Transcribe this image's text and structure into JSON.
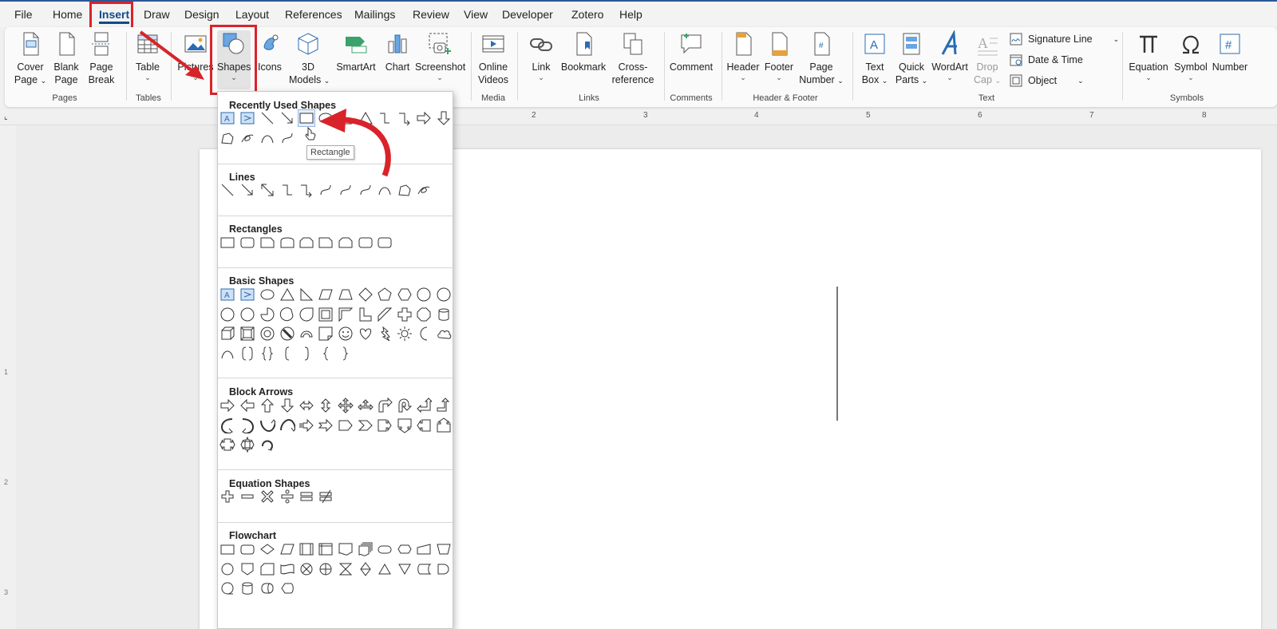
{
  "menu": {
    "tabs": [
      {
        "label": "File"
      },
      {
        "label": "Home"
      },
      {
        "label": "Insert"
      },
      {
        "label": "Draw"
      },
      {
        "label": "Design"
      },
      {
        "label": "Layout"
      },
      {
        "label": "References"
      },
      {
        "label": "Mailings"
      },
      {
        "label": "Review"
      },
      {
        "label": "View"
      },
      {
        "label": "Developer"
      },
      {
        "label": "Zotero"
      },
      {
        "label": "Help"
      }
    ],
    "active_tab": "Insert"
  },
  "ribbon": {
    "buttons": {
      "cover_page": [
        "Cover",
        "Page"
      ],
      "blank_page": [
        "Blank",
        "Page"
      ],
      "page_break": [
        "Page",
        "Break"
      ],
      "table": "Table",
      "pictures": "Pictures",
      "shapes": "Shapes",
      "icons": "Icons",
      "models_3d": [
        "3D",
        "Models"
      ],
      "smartart": "SmartArt",
      "chart": "Chart",
      "screenshot": "Screenshot",
      "online_videos": [
        "Online",
        "Videos"
      ],
      "link": "Link",
      "bookmark": "Bookmark",
      "cross_reference": [
        "Cross-",
        "reference"
      ],
      "comment": "Comment",
      "header": "Header",
      "footer": "Footer",
      "page_number": [
        "Page",
        "Number"
      ],
      "text_box": [
        "Text",
        "Box"
      ],
      "quick_parts": [
        "Quick",
        "Parts"
      ],
      "wordart": "WordArt",
      "drop_cap": [
        "Drop",
        "Cap"
      ],
      "signature_line": "Signature Line",
      "date_time": "Date & Time",
      "object": "Object",
      "equation": "Equation",
      "symbol": "Symbol",
      "number": "Number"
    },
    "groups": {
      "pages": "Pages",
      "tables": "Tables",
      "media": "Media",
      "links": "Links",
      "comments": "Comments",
      "header_footer": "Header & Footer",
      "text": "Text",
      "symbols": "Symbols"
    }
  },
  "ruler": {
    "numbers": [
      "2",
      "3",
      "4",
      "5",
      "6",
      "7",
      "8"
    ],
    "vertical_numbers": [
      "1",
      "2",
      "3"
    ]
  },
  "shapes_gallery": {
    "sections": {
      "recent": "Recently Used Shapes",
      "lines": "Lines",
      "rectangles": "Rectangles",
      "basic": "Basic Shapes",
      "block_arrows": "Block Arrows",
      "equation": "Equation Shapes",
      "flowchart": "Flowchart"
    },
    "tooltip": "Rectangle"
  },
  "colors": {
    "accent": "#0f4a8a",
    "annotation": "#d9232a"
  }
}
